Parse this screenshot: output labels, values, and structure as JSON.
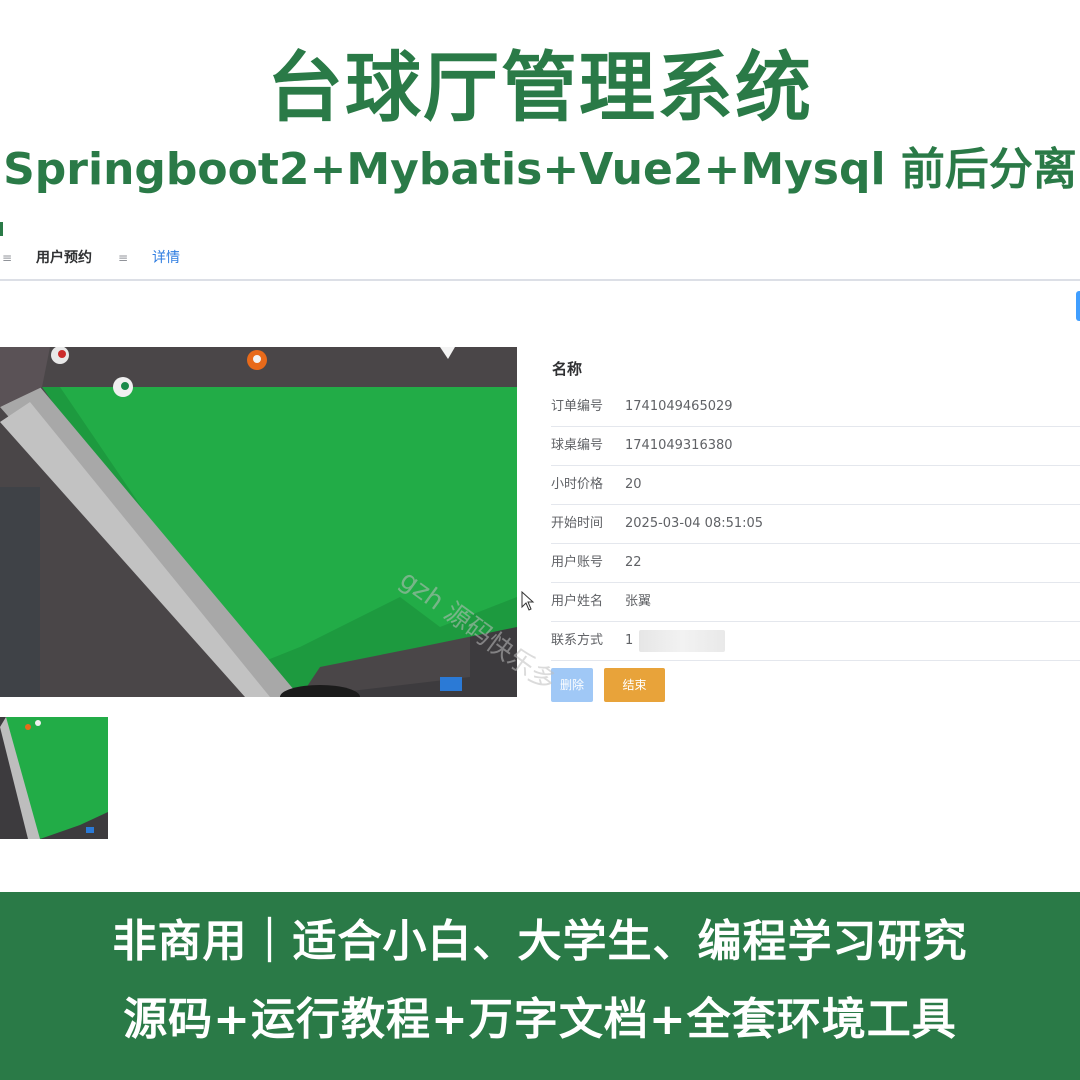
{
  "banner": {
    "title": "台球厅管理系统",
    "subtitle": "Springboot2+Mybatis+Vue2+Mysql 前后分离"
  },
  "tabs": [
    {
      "handle": "≡",
      "label": "用户预约"
    },
    {
      "handle": "≡",
      "label": "详情"
    }
  ],
  "detail": {
    "title": "名称",
    "rows": [
      {
        "label": "订单编号",
        "value": "1741049465029"
      },
      {
        "label": "球桌编号",
        "value": "1741049316380"
      },
      {
        "label": "小时价格",
        "value": "20"
      },
      {
        "label": "开始时间",
        "value": "2025-03-04 08:51:05"
      },
      {
        "label": "用户账号",
        "value": "22"
      },
      {
        "label": "用户姓名",
        "value": "张翼"
      },
      {
        "label": "联系方式",
        "value": "1"
      }
    ]
  },
  "buttons": {
    "delete": "删除",
    "finish": "结束"
  },
  "watermark": "gzh 源码快乐多",
  "footer": {
    "line1": "非商用｜适合小白、大学生、编程学习研究",
    "line2": "源码+运行教程+万字文档+全套环境工具"
  },
  "colors": {
    "brand_green": "#2a7a47",
    "link_blue": "#2f7de1",
    "delete_button": "#a0c8f6",
    "finish_button": "#e8a33a"
  }
}
